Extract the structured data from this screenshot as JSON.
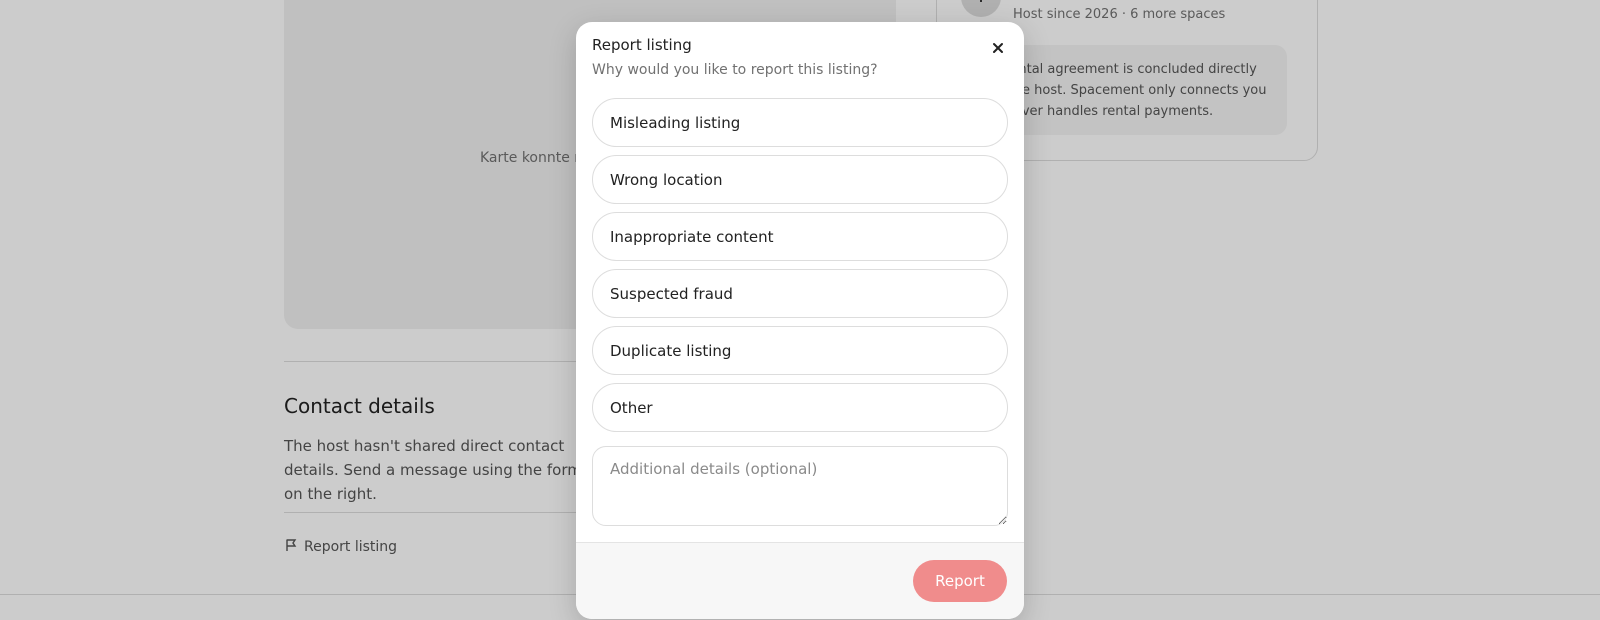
{
  "background": {
    "map_error": "Karte konnte nicht geladen werden.",
    "host": {
      "avatar_initial": "T",
      "meta": "Host since 2026 · 6 more spaces",
      "notice": "The rental agreement is concluded directly with the host. Spacement only connects you and never handles rental payments."
    },
    "contact": {
      "heading": "Contact details",
      "text": "The host hasn't shared direct contact details. Send a message using the form on the right."
    },
    "report_link_label": "Report listing"
  },
  "modal": {
    "title": "Report listing",
    "subtitle": "Why would you like to report this listing?",
    "close_icon": "close-icon",
    "reasons": [
      {
        "label": "Misleading listing"
      },
      {
        "label": "Wrong location"
      },
      {
        "label": "Inappropriate content"
      },
      {
        "label": "Suspected fraud"
      },
      {
        "label": "Duplicate listing"
      },
      {
        "label": "Other"
      }
    ],
    "details_placeholder": "Additional details (optional)",
    "submit_label": "Report"
  },
  "colors": {
    "overlay": "rgba(0,0,0,0.2)",
    "submit_disabled": "#f08c8c",
    "text_primary": "#222222",
    "text_secondary": "#717171"
  }
}
